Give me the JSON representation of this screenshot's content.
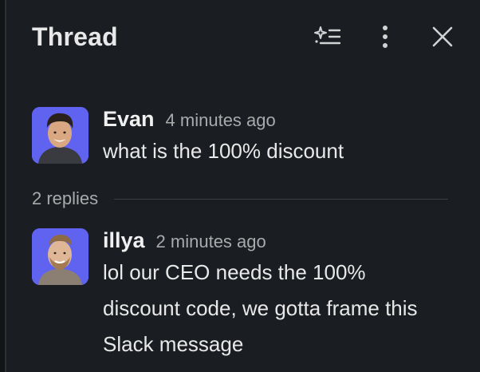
{
  "panel": {
    "title": "Thread",
    "actions": [
      {
        "icon": "sparkle-list-icon"
      },
      {
        "icon": "more-vertical-icon"
      },
      {
        "icon": "close-icon"
      }
    ]
  },
  "parent_message": {
    "author": "Evan",
    "time": "4 minutes ago",
    "text": "what is the 100% discount"
  },
  "replies": {
    "count_label": "2 replies"
  },
  "reply_message": {
    "author": "illya",
    "time": "2 minutes ago",
    "text": "lol our CEO needs the 100% discount code, we gotta frame this Slack message"
  },
  "colors": {
    "background": "#1a1d21",
    "avatar_bg": "#5f63f0",
    "muted_text": "#a9aaab",
    "primary_text": "#e8e8e8"
  }
}
